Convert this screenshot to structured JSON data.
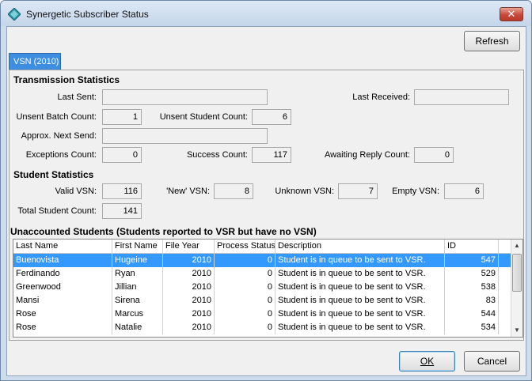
{
  "window": {
    "title": "Synergetic Subscriber Status",
    "close_glyph": "✕"
  },
  "toolbar": {
    "refresh_label": "Refresh"
  },
  "tab": {
    "label": "VSN (2010)"
  },
  "transmission": {
    "heading": "Transmission Statistics",
    "last_sent_label": "Last Sent:",
    "last_sent_value": "",
    "last_received_label": "Last Received:",
    "last_received_value": "",
    "unsent_batch_label": "Unsent Batch Count:",
    "unsent_batch_value": "1",
    "unsent_student_label": "Unsent Student Count:",
    "unsent_student_value": "6",
    "next_send_label": "Approx. Next Send:",
    "next_send_value": "",
    "exceptions_label": "Exceptions Count:",
    "exceptions_value": "0",
    "success_label": "Success Count:",
    "success_value": "117",
    "awaiting_label": "Awaiting Reply Count:",
    "awaiting_value": "0"
  },
  "student": {
    "heading": "Student Statistics",
    "valid_label": "Valid VSN:",
    "valid_value": "116",
    "new_label": "'New' VSN:",
    "new_value": "8",
    "unknown_label": "Unknown VSN:",
    "unknown_value": "7",
    "empty_label": "Empty VSN:",
    "empty_value": "6",
    "total_label": "Total Student Count:",
    "total_value": "141"
  },
  "unaccounted": {
    "heading": "Unaccounted Students (Students reported to VSR but have no VSN)",
    "columns": [
      "Last Name",
      "First Name",
      "File Year",
      "Process Status",
      "Description",
      "ID"
    ],
    "rows": [
      {
        "last": "Buenovista",
        "first": "Hugeine",
        "year": "2010",
        "status": "0",
        "desc": "Student is in queue to be sent to VSR.",
        "id": "547",
        "selected": true
      },
      {
        "last": "Ferdinando",
        "first": "Ryan",
        "year": "2010",
        "status": "0",
        "desc": "Student is in queue to be sent to VSR.",
        "id": "529",
        "selected": false
      },
      {
        "last": "Greenwood",
        "first": "Jillian",
        "year": "2010",
        "status": "0",
        "desc": "Student is in queue to be sent to VSR.",
        "id": "538",
        "selected": false
      },
      {
        "last": "Mansi",
        "first": "Sirena",
        "year": "2010",
        "status": "0",
        "desc": "Student is in queue to be sent to VSR.",
        "id": "83",
        "selected": false
      },
      {
        "last": "Rose",
        "first": "Marcus",
        "year": "2010",
        "status": "0",
        "desc": "Student is in queue to be sent to VSR.",
        "id": "544",
        "selected": false
      },
      {
        "last": "Rose",
        "first": "Natalie",
        "year": "2010",
        "status": "0",
        "desc": "Student is in queue to be sent to VSR.",
        "id": "534",
        "selected": false
      }
    ]
  },
  "footer": {
    "ok_label": "OK",
    "cancel_label": "Cancel"
  },
  "colors": {
    "selection": "#3399ff",
    "tab": "#3d8ee0",
    "titlebar": "#cfdcec"
  }
}
